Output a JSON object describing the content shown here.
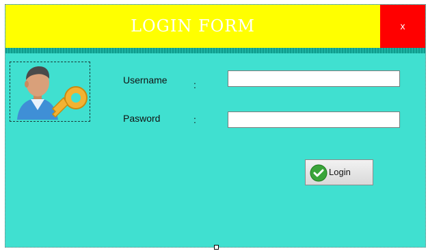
{
  "window": {
    "title": "LOGIN FORM",
    "close_label": "x"
  },
  "fields": {
    "username_label": "Username",
    "username_colon": ":",
    "username_value": "",
    "password_label": "Pasword",
    "password_colon": ":",
    "password_value": ""
  },
  "actions": {
    "login_label": "Login"
  },
  "icons": {
    "avatar": "user-key-icon",
    "login": "checkmark-icon"
  },
  "colors": {
    "title_bar": "#FFFF00",
    "close_button": "#FF0000",
    "form_background": "#40E0D0",
    "divider": "#1fb3a3"
  }
}
